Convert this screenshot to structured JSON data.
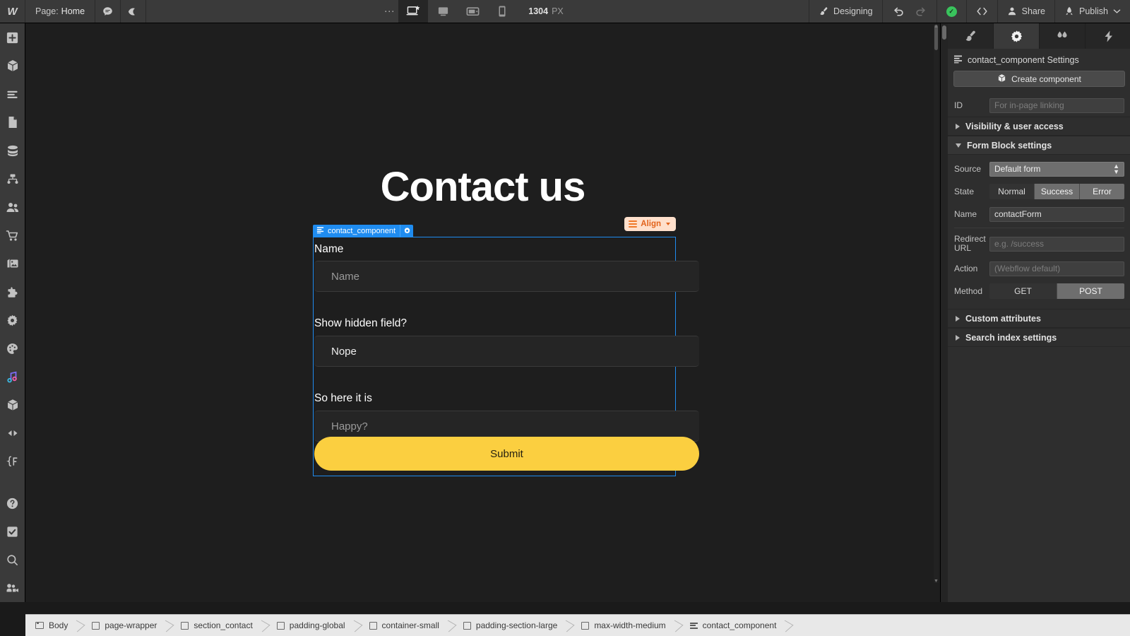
{
  "topbar": {
    "logo": "W",
    "page_prefix": "Page:",
    "page_name": "Home",
    "comment_icon": "comment-icon",
    "preview_icon": "eye-icon",
    "more_icon": "kebab-menu-icon",
    "breakpoints": [
      {
        "name": "desktop-large-breakpoint",
        "icon": "monitor-star-icon",
        "active": true
      },
      {
        "name": "desktop-breakpoint",
        "icon": "desktop-icon",
        "active": false
      },
      {
        "name": "tablet-breakpoint",
        "icon": "tablet-icon",
        "active": false
      },
      {
        "name": "mobile-breakpoint",
        "icon": "mobile-icon",
        "active": false
      }
    ],
    "viewport_width": "1304",
    "viewport_unit": "PX",
    "mode_label": "Designing",
    "mode_icon": "paintbrush-icon",
    "undo_icon": "undo-arrow-icon",
    "redo_icon": "redo-arrow-icon",
    "status_icon": "checkmark-saved-icon",
    "code_icon": "code-brackets-icon",
    "share_label": "Share",
    "share_icon": "person-icon",
    "publish_label": "Publish",
    "publish_icon": "rocket-icon",
    "publish_caret": "chevron-down-icon"
  },
  "left_rail": {
    "items": [
      {
        "name": "add-elements",
        "icon": "plus-square-icon"
      },
      {
        "name": "components-panel",
        "icon": "cube-icon"
      },
      {
        "name": "navigator-panel",
        "icon": "layers-lines-icon"
      },
      {
        "name": "pages-panel",
        "icon": "page-icon"
      },
      {
        "name": "cms-panel",
        "icon": "database-icon"
      },
      {
        "name": "logic-panel",
        "icon": "flow-nodes-icon"
      },
      {
        "name": "users-panel",
        "icon": "people-icon"
      },
      {
        "name": "ecommerce-panel",
        "icon": "shopping-cart-icon"
      },
      {
        "name": "assets-panel",
        "icon": "images-icon"
      },
      {
        "name": "apps-panel",
        "icon": "puzzle-piece-icon"
      },
      {
        "name": "settings-panel",
        "icon": "gear-icon"
      },
      {
        "name": "style-guide-panel",
        "icon": "palette-icon"
      },
      {
        "name": "audio-interactions-panel",
        "icon": "music-note-icon"
      },
      {
        "name": "libraries-panel",
        "icon": "box-icon"
      },
      {
        "name": "variants-panel",
        "icon": "arrows-lr-icon"
      },
      {
        "name": "variables-panel",
        "icon": "curly-f-icon"
      },
      {
        "name": "help-panel",
        "icon": "question-circle-icon"
      },
      {
        "name": "audit-panel",
        "icon": "checkbox-check-icon"
      },
      {
        "name": "search-panel",
        "icon": "magnifier-icon"
      },
      {
        "name": "video-panel",
        "icon": "video-camera-icon"
      }
    ]
  },
  "canvas": {
    "page_heading": "Contact us",
    "align_button": {
      "label": "Align",
      "icon": "align-lines-icon",
      "caret": "chevron-down-icon"
    },
    "component_badge": {
      "label": "contact_component",
      "icon": "component-lines-icon",
      "gear": "gear-icon"
    },
    "form": {
      "fields": [
        {
          "label": "Name",
          "placeholder": "Name",
          "value": "",
          "filled": false
        },
        {
          "label": "Show hidden field?",
          "placeholder": "",
          "value": "Nope",
          "filled": true
        },
        {
          "label": "So here it is",
          "placeholder": "Happy?",
          "value": "",
          "filled": false
        }
      ],
      "submit_label": "Submit",
      "submit_color": "#fbcf40"
    }
  },
  "right_panel": {
    "tabs": [
      {
        "name": "style-tab",
        "icon": "paintbrush-icon",
        "active": false
      },
      {
        "name": "settings-tab",
        "icon": "gear-icon",
        "active": true
      },
      {
        "name": "interactions-tab",
        "icon": "droplets-icon",
        "active": false
      },
      {
        "name": "effects-tab",
        "icon": "lightning-bolt-icon",
        "active": false
      }
    ],
    "header_title": "contact_component Settings",
    "header_icon": "component-lines-icon",
    "create_component_label": "Create component",
    "create_component_icon": "cube-icon",
    "id_label": "ID",
    "id_placeholder": "For in-page linking",
    "id_value": "",
    "visibility_section": "Visibility & user access",
    "form_block_section": "Form Block settings",
    "source_label": "Source",
    "source_value": "Default form",
    "state_label": "State",
    "state_options": [
      "Normal",
      "Success",
      "Error"
    ],
    "state_selected": "Normal",
    "name_label": "Name",
    "name_value": "contactForm",
    "redirect_label": "Redirect URL",
    "redirect_placeholder": "e.g. /success",
    "redirect_value": "",
    "action_label": "Action",
    "action_placeholder": "(Webflow default)",
    "action_value": "",
    "method_label": "Method",
    "method_options": [
      "GET",
      "POST"
    ],
    "method_selected": "POST",
    "custom_attributes_section": "Custom attributes",
    "search_index_section": "Search index settings"
  },
  "breadcrumb": {
    "items": [
      {
        "label": "Body",
        "icon": "body-icon"
      },
      {
        "label": "page-wrapper",
        "icon": "div-square-icon"
      },
      {
        "label": "section_contact",
        "icon": "div-square-icon"
      },
      {
        "label": "padding-global",
        "icon": "div-square-icon"
      },
      {
        "label": "container-small",
        "icon": "div-square-icon"
      },
      {
        "label": "padding-section-large",
        "icon": "div-square-icon"
      },
      {
        "label": "max-width-medium",
        "icon": "div-square-icon"
      },
      {
        "label": "contact_component",
        "icon": "component-lines-icon"
      }
    ]
  }
}
